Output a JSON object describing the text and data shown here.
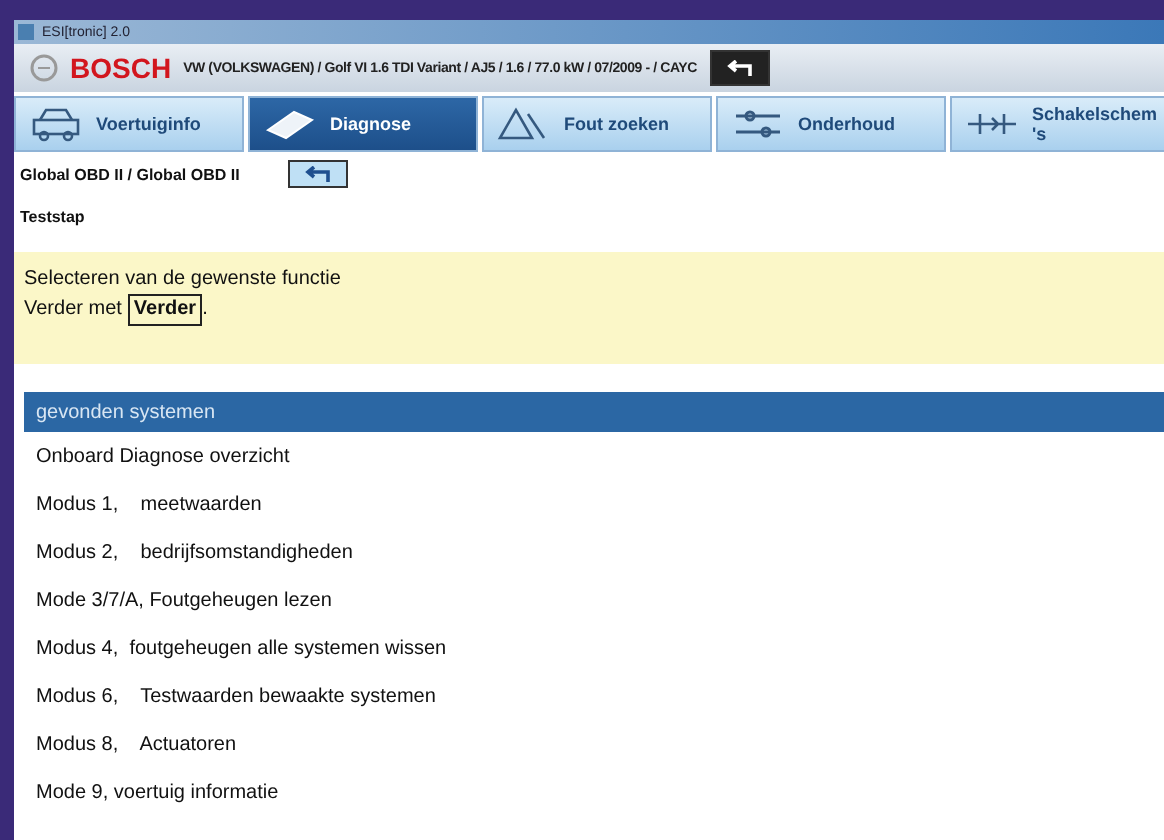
{
  "window": {
    "title": "ESI[tronic] 2.0"
  },
  "header": {
    "brand": "BOSCH",
    "vehicle": "VW (VOLKSWAGEN) / Golf VI 1.6 TDI Variant / AJ5 / 1.6 / 77.0 kW / 07/2009 - / CAYC"
  },
  "tabs": [
    {
      "label": "Voertuiginfo",
      "kind": "car",
      "selected": false
    },
    {
      "label": "Diagnose",
      "kind": "plug",
      "selected": true
    },
    {
      "label": "Fout zoeken",
      "kind": "warning",
      "selected": false
    },
    {
      "label": "Onderhoud",
      "kind": "tools",
      "selected": false
    },
    {
      "label": "Schakelschem\n's",
      "kind": "circuit",
      "selected": false
    }
  ],
  "breadcrumb": {
    "path": "Global OBD II / Global OBD II",
    "step": "Teststap"
  },
  "instructions": {
    "line_1": "Selecteren van de gewenste functie",
    "line_2_prefix": "Verder met",
    "line_2_key": "Verder",
    "line_2_suffix": "."
  },
  "list": {
    "header": "gevonden systemen",
    "items": [
      {
        "label": "Onboard Diagnose overzicht"
      },
      {
        "label": "Modus 1,    meetwaarden"
      },
      {
        "label": "Modus 2,    bedrijfsomstandigheden"
      },
      {
        "label": "Mode 3/7/A, Foutgeheugen lezen"
      },
      {
        "label": "Modus 4,  foutgeheugen alle systemen wissen"
      },
      {
        "label": "Modus 6,    Testwaarden bewaakte systemen"
      },
      {
        "label": "Modus 8,    Actuatoren"
      },
      {
        "label": "Mode 9, voertuig informatie"
      }
    ]
  }
}
